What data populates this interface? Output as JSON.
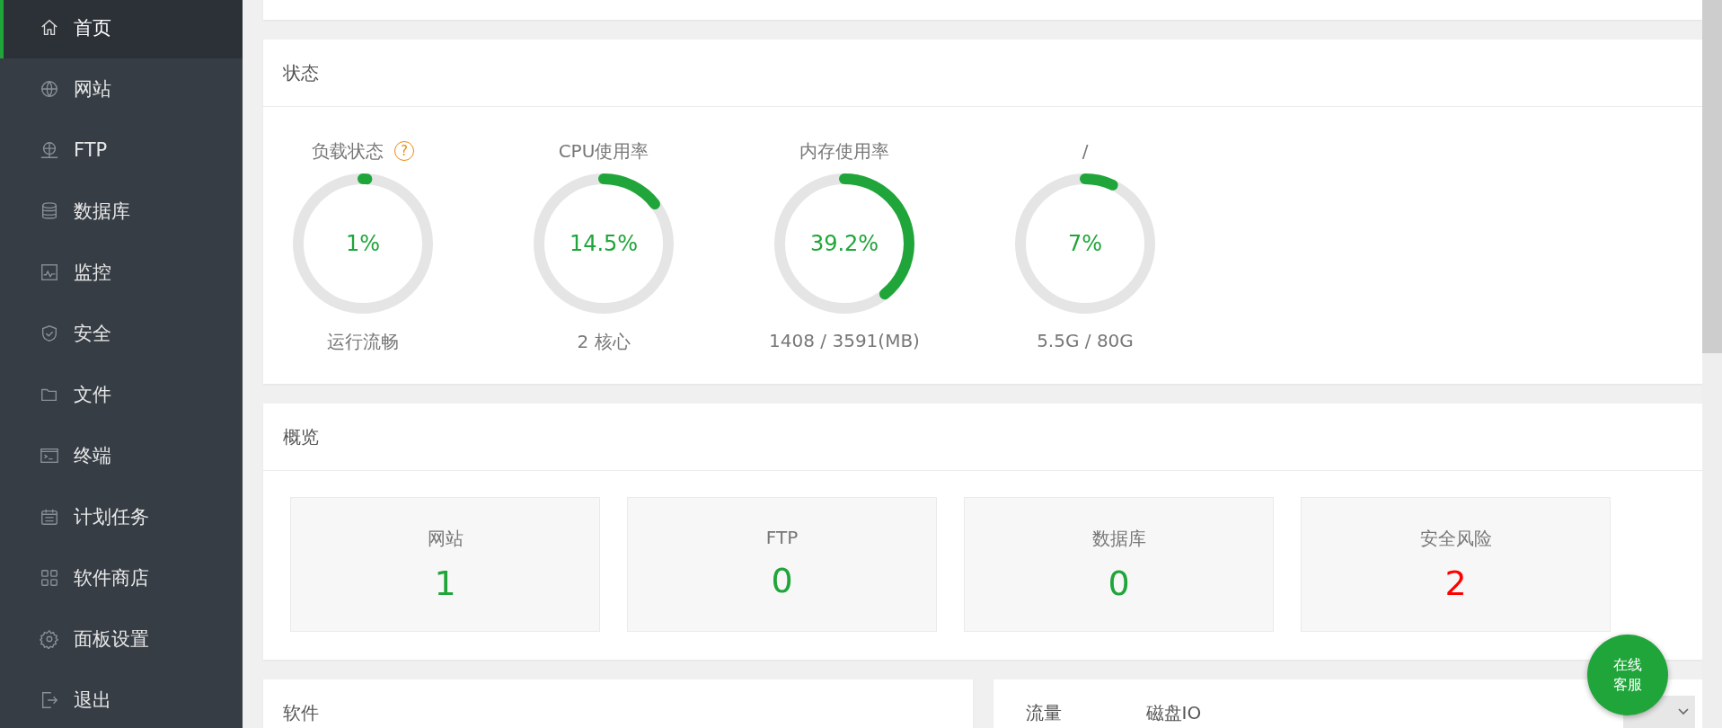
{
  "sidebar": {
    "items": [
      {
        "label": "首页",
        "selected": true
      },
      {
        "label": "网站",
        "selected": false
      },
      {
        "label": "FTP",
        "selected": false
      },
      {
        "label": "数据库",
        "selected": false
      },
      {
        "label": "监控",
        "selected": false
      },
      {
        "label": "安全",
        "selected": false
      },
      {
        "label": "文件",
        "selected": false
      },
      {
        "label": "终端",
        "selected": false
      },
      {
        "label": "计划任务",
        "selected": false
      },
      {
        "label": "软件商店",
        "selected": false
      },
      {
        "label": "面板设置",
        "selected": false
      },
      {
        "label": "退出",
        "selected": false
      }
    ]
  },
  "status": {
    "title": "状态",
    "gauges": [
      {
        "title": "负载状态",
        "help": "?",
        "value": "1%",
        "level": 0.01,
        "caption": "运行流畅"
      },
      {
        "title": "CPU使用率",
        "value": "14.5%",
        "level": 0.145,
        "caption": "2 核心"
      },
      {
        "title": "内存使用率",
        "value": "39.2%",
        "level": 0.392,
        "caption": "1408 / 3591(MB)"
      },
      {
        "title": "/",
        "value": "7%",
        "level": 0.07,
        "caption": "5.5G / 80G"
      }
    ]
  },
  "overview": {
    "title": "概览",
    "stats": [
      {
        "label": "网站",
        "value": "1",
        "color": "#20a53a"
      },
      {
        "label": "FTP",
        "value": "0",
        "color": "#20a53a"
      },
      {
        "label": "数据库",
        "value": "0",
        "color": "#20a53a"
      },
      {
        "label": "安全风险",
        "value": "2",
        "color": "#ff0000"
      }
    ]
  },
  "software": {
    "title": "软件"
  },
  "charts_panel": {
    "tabs": [
      "流量",
      "磁盘IO"
    ]
  },
  "chat_button": {
    "lines": [
      "在线",
      "客服"
    ]
  }
}
